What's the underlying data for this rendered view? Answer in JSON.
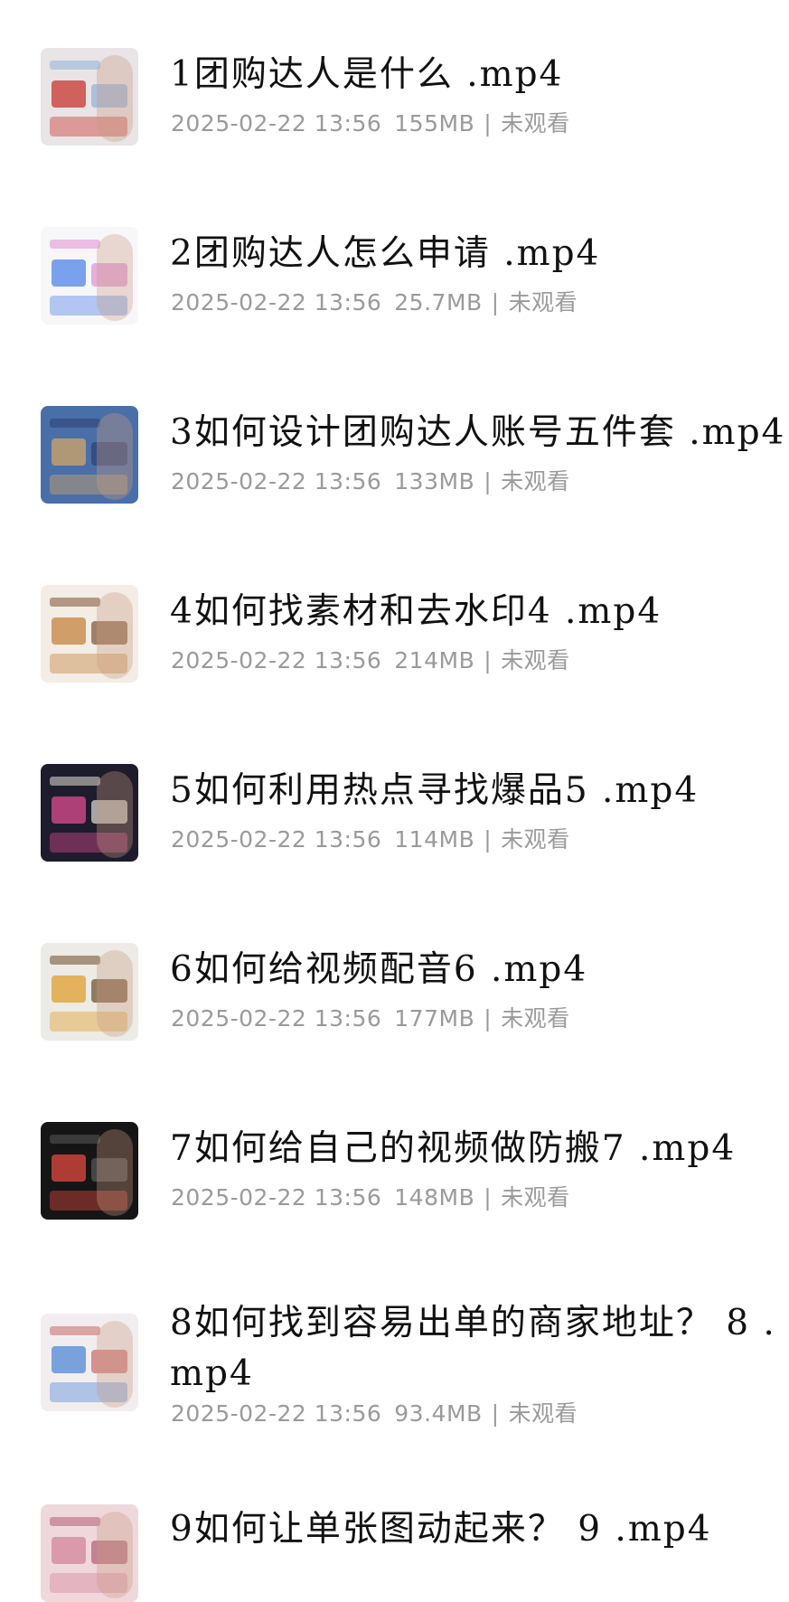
{
  "videos": [
    {
      "title": "1团购达人是什么 .mp4",
      "date": "2025-02-22 13:56",
      "size": "155MB",
      "status": "未观看",
      "thumb": {
        "bg": "#e9e4e6",
        "accent": "#c9403a",
        "mid": "#8fb0d8"
      }
    },
    {
      "title": "2团购达人怎么申请 .mp4",
      "date": "2025-02-22 13:56",
      "size": "25.7MB",
      "status": "未观看",
      "thumb": {
        "bg": "#f7f7fa",
        "accent": "#5a8be8",
        "mid": "#e08fd0"
      }
    },
    {
      "title": "3如何设计团购达人账号五件套 .mp4",
      "date": "2025-02-22 13:56",
      "size": "133MB",
      "status": "未观看",
      "thumb": {
        "bg": "#4a6fa8",
        "accent": "#c9a36a",
        "mid": "#2c3f70"
      }
    },
    {
      "title": "4如何找素材和去水印4 .mp4",
      "date": "2025-02-22 13:56",
      "size": "214MB",
      "status": "未观看",
      "thumb": {
        "bg": "#f3ede6",
        "accent": "#c78a48",
        "mid": "#7c5230"
      }
    },
    {
      "title": "5如何利用热点寻找爆品5 .mp4",
      "date": "2025-02-22 13:56",
      "size": "114MB",
      "status": "未观看",
      "thumb": {
        "bg": "#1d1c2c",
        "accent": "#d24a8a",
        "mid": "#e3e0d6"
      }
    },
    {
      "title": "6如何给视频配音6 .mp4",
      "date": "2025-02-22 13:56",
      "size": "177MB",
      "status": "未观看",
      "thumb": {
        "bg": "#ecebe6",
        "accent": "#e0a53a",
        "mid": "#6b4a2a"
      }
    },
    {
      "title": "7如何给自己的视频做防搬7 .mp4",
      "date": "2025-02-22 13:56",
      "size": "148MB",
      "status": "未观看",
      "thumb": {
        "bg": "#151515",
        "accent": "#d6463c",
        "mid": "#5a5a5a"
      }
    },
    {
      "title": "8如何找到容易出单的商家地址？ 8 .mp4",
      "date": "2025-02-22 13:56",
      "size": "93.4MB",
      "status": "未观看",
      "thumb": {
        "bg": "#f2eef0",
        "accent": "#5a8ed8",
        "mid": "#c76a6a"
      }
    },
    {
      "title": "9如何让单张图动起来？ 9 .mp4",
      "date": "",
      "size": "",
      "status": "",
      "thumb": {
        "bg": "#efd8dc",
        "accent": "#d68aa0",
        "mid": "#b25c74"
      }
    }
  ]
}
